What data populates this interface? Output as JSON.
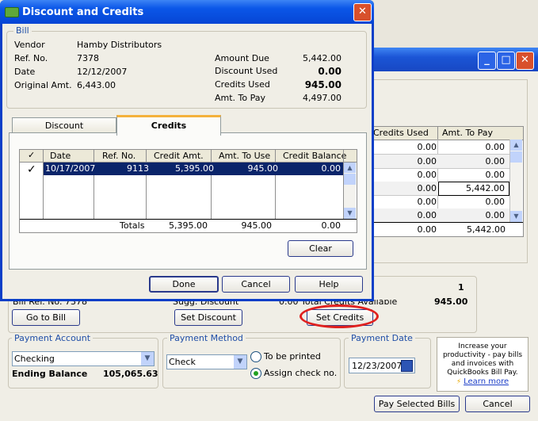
{
  "main_window": {
    "grid_headers": [
      "Credits Used",
      "Amt. To Pay"
    ],
    "rows": [
      {
        "credits_used": "0.00",
        "amt_to_pay": "0.00"
      },
      {
        "credits_used": "0.00",
        "amt_to_pay": "0.00"
      },
      {
        "credits_used": "0.00",
        "amt_to_pay": "0.00"
      },
      {
        "credits_used": "0.00",
        "amt_to_pay": "5,442.00"
      },
      {
        "credits_used": "0.00",
        "amt_to_pay": "0.00"
      },
      {
        "credits_used": "0.00",
        "amt_to_pay": "0.00"
      }
    ],
    "totals": {
      "credits_used": "0.00",
      "amt_to_pay": "5,442.00"
    },
    "info": {
      "bill_ref_partial": "Bill Ref. No. 7378",
      "sugg_discount_partial": "Sugg. Discount",
      "sugg_discount_value_partial": "0.00",
      "available_label_partial": "Total Credits Available",
      "count": "1",
      "available_value": "945.00"
    },
    "buttons": {
      "go_to_bill": "Go to Bill",
      "set_discount": "Set Discount",
      "set_credits": "Set Credits",
      "pay_selected": "Pay Selected Bills",
      "cancel": "Cancel"
    },
    "payment_account": {
      "label": "Payment Account",
      "value": "Checking",
      "ending_balance_label": "Ending Balance",
      "ending_balance": "105,065.63"
    },
    "payment_method": {
      "label": "Payment Method",
      "value": "Check",
      "option1": "To be printed",
      "option2": "Assign check no."
    },
    "payment_date": {
      "label": "Payment Date",
      "value": "12/23/2007"
    },
    "promo": {
      "line1": "Increase your",
      "line2": "productivity - pay bills",
      "line3": "and invoices with",
      "line4": "QuickBooks Bill Pay.",
      "link": "Learn more"
    }
  },
  "dialog": {
    "title": "Discount and Credits",
    "bill_group": "Bill",
    "vendor_label": "Vendor",
    "vendor": "Hamby Distributors",
    "ref_label": "Ref. No.",
    "ref": "7378",
    "date_label": "Date",
    "date": "12/12/2007",
    "orig_label": "Original Amt.",
    "orig": "6,443.00",
    "amount_due_label": "Amount Due",
    "amount_due": "5,442.00",
    "discount_used_label": "Discount Used",
    "discount_used": "0.00",
    "credits_used_label": "Credits Used",
    "credits_used": "945.00",
    "amt_to_pay_label": "Amt. To Pay",
    "amt_to_pay": "4,497.00",
    "tabs": [
      "Discount",
      "Credits"
    ],
    "credits_table": {
      "headers": [
        "✓",
        "Date",
        "Ref. No.",
        "Credit Amt.",
        "Amt. To Use",
        "Credit Balance"
      ],
      "row": {
        "check": "✓",
        "date": "10/17/2007",
        "ref": "9113",
        "credit_amt": "5,395.00",
        "amt_to_use": "945.00",
        "balance": "0.00"
      },
      "totals_label": "Totals",
      "totals": {
        "credit_amt": "5,395.00",
        "amt_to_use": "945.00",
        "balance": "0.00"
      }
    },
    "buttons": {
      "clear": "Clear",
      "done": "Done",
      "cancel": "Cancel",
      "help": "Help"
    }
  },
  "colors": {
    "titlebar": "#1b55d6",
    "selection": "#0a246a",
    "highlight_circle": "#e0201e",
    "close": "#d8502c"
  }
}
